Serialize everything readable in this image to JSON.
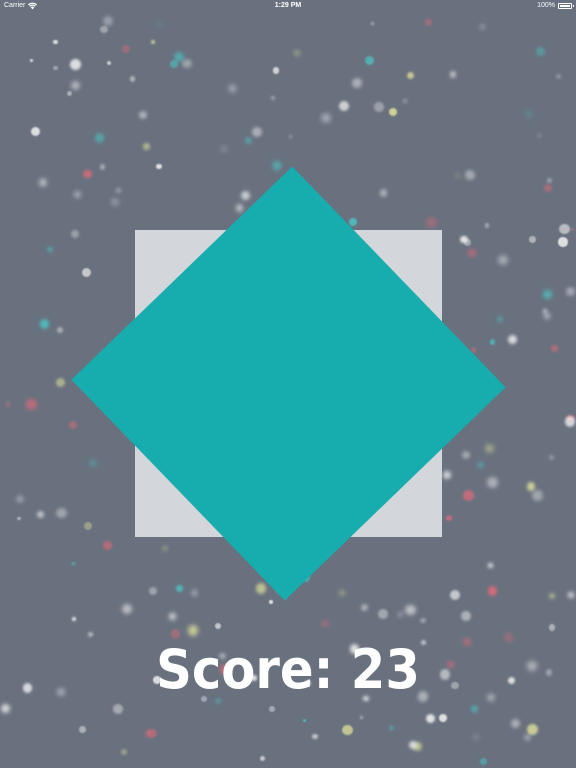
{
  "status_bar": {
    "carrier": "Carrier",
    "time": "1:29 PM",
    "battery_percent": "100%",
    "battery_level": 1.0,
    "signal_icon": "wifi-icon",
    "battery_icon": "battery-icon"
  },
  "game": {
    "score_label": "Score: 23",
    "score": 23,
    "colors": {
      "background": "#69717f",
      "target_square": "#d3d6da",
      "player_diamond": "#17acad",
      "score_text": "#ffffff",
      "particle_white": "#f2f2f2",
      "particle_pink": "#e86a78",
      "particle_teal": "#4cc6c4",
      "particle_yellow": "#e3e59a"
    }
  }
}
